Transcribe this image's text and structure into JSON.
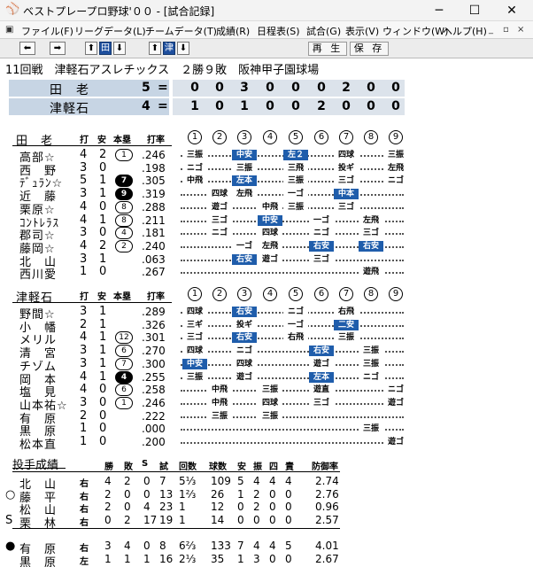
{
  "window": {
    "title": "ベストプレープロ野球'００ - [試合記録]",
    "min": "─",
    "max": "☐",
    "close": "✕"
  },
  "menu": [
    {
      "label": "ファイル(F)"
    },
    {
      "label": "リーグデータ(L)"
    },
    {
      "label": "チームデータ(T)"
    },
    {
      "label": "成績(R)"
    },
    {
      "label": "日程表(S)"
    },
    {
      "label": "試合(G)"
    },
    {
      "label": "表示(V)"
    },
    {
      "label": "ウィンドウ(W)"
    },
    {
      "label": "ヘルプ(H)"
    }
  ],
  "mdi": {
    "min": "_",
    "restore": "▫",
    "close": "×"
  },
  "toolbar": {
    "prev": "⬅",
    "next": "➡",
    "up1": "⬆",
    "team1": "田",
    "down1": "⬇",
    "up2": "⬆",
    "team2": "津",
    "down2": "⬇",
    "replay": "再 生",
    "save": "保 存"
  },
  "game": {
    "info": "11回戦　津軽石アスレチックス　２勝９敗　阪神甲子園球場",
    "line": [
      {
        "team": "田　老",
        "runs": "5",
        "eq": "=",
        "inn": [
          "0",
          "0",
          "3",
          "0",
          "0",
          "0",
          "2",
          "0",
          "0"
        ]
      },
      {
        "team": "津軽石",
        "runs": "4",
        "eq": "=",
        "inn": [
          "1",
          "0",
          "1",
          "0",
          "0",
          "2",
          "0",
          "0",
          "0"
        ]
      }
    ]
  },
  "headers": {
    "ab": "打",
    "h": "安",
    "hr": "本塁",
    "avg": "打率",
    "innings": [
      "1",
      "2",
      "3",
      "4",
      "5",
      "6",
      "7",
      "8",
      "9"
    ]
  },
  "away": {
    "team": "田　老",
    "batters": [
      {
        "name": "高部☆",
        "ab": "4",
        "h": "2",
        "hr": "1",
        "dark": false,
        "avg": ".246",
        "res": [
          [
            "三振",
            0
          ],
          [
            "",
            0
          ],
          [
            "中安",
            1
          ],
          [
            "",
            0
          ],
          [
            "左２",
            1
          ],
          [
            "",
            0
          ],
          [
            "四球",
            0
          ],
          [
            "",
            0
          ],
          [
            "三振",
            0
          ]
        ]
      },
      {
        "name": "西　野",
        "ab": "3",
        "h": "0",
        "hr": "",
        "dark": false,
        "avg": ".198",
        "res": [
          [
            "ニゴ",
            0
          ],
          [
            "",
            0
          ],
          [
            "三振",
            0
          ],
          [
            "",
            0
          ],
          [
            "三飛",
            0
          ],
          [
            "",
            0
          ],
          [
            "投ギ",
            0
          ],
          [
            "",
            0
          ],
          [
            "左飛",
            0
          ]
        ]
      },
      {
        "name": "ﾃﾞｭﾗﾝ☆",
        "ab": "5",
        "h": "1",
        "hr": "7",
        "dark": true,
        "avg": ".305",
        "res": [
          [
            "中飛",
            0
          ],
          [
            "",
            0
          ],
          [
            "左本",
            1
          ],
          [
            "",
            0
          ],
          [
            "三振",
            0
          ],
          [
            "",
            0
          ],
          [
            "三ゴ",
            0
          ],
          [
            "",
            0
          ],
          [
            "ニゴ",
            0
          ]
        ]
      },
      {
        "name": "近　藤",
        "ab": "3",
        "h": "1",
        "hr": "9",
        "dark": true,
        "avg": ".319",
        "res": [
          [
            "",
            0
          ],
          [
            "四球",
            0
          ],
          [
            "左飛",
            0
          ],
          [
            "",
            0
          ],
          [
            "一ゴ",
            0
          ],
          [
            "",
            0
          ],
          [
            "中本",
            1
          ],
          [
            "",
            0
          ],
          [
            "",
            0
          ]
        ]
      },
      {
        "name": "栗原☆",
        "ab": "4",
        "h": "0",
        "hr": "8",
        "dark": false,
        "avg": ".288",
        "res": [
          [
            "",
            0
          ],
          [
            "遊ゴ",
            0
          ],
          [
            "",
            0
          ],
          [
            "中飛",
            0
          ],
          [
            "三振",
            0
          ],
          [
            "",
            0
          ],
          [
            "三ゴ",
            0
          ],
          [
            "",
            0
          ],
          [
            "",
            0
          ]
        ]
      },
      {
        "name": "ｺﾝﾄﾚﾗｽ",
        "ab": "4",
        "h": "1",
        "hr": "8",
        "dark": false,
        "avg": ".211",
        "res": [
          [
            "",
            0
          ],
          [
            "三ゴ",
            0
          ],
          [
            "",
            0
          ],
          [
            "中安",
            1
          ],
          [
            "",
            0
          ],
          [
            "一ゴ",
            0
          ],
          [
            "",
            0
          ],
          [
            "左飛",
            0
          ],
          [
            "",
            0
          ]
        ]
      },
      {
        "name": "郡司☆",
        "ab": "3",
        "h": "0",
        "hr": "4",
        "dark": false,
        "avg": ".181",
        "res": [
          [
            "",
            0
          ],
          [
            "ニゴ",
            0
          ],
          [
            "",
            0
          ],
          [
            "四球",
            0
          ],
          [
            "",
            0
          ],
          [
            "ニゴ",
            0
          ],
          [
            "",
            0
          ],
          [
            "三ゴ",
            0
          ],
          [
            "",
            0
          ]
        ]
      },
      {
        "name": "藤岡☆",
        "ab": "4",
        "h": "2",
        "hr": "2",
        "dark": false,
        "avg": ".240",
        "res": [
          [
            "",
            0
          ],
          [
            "",
            0
          ],
          [
            "一ゴ",
            0
          ],
          [
            "左飛",
            0
          ],
          [
            "",
            0
          ],
          [
            "右安",
            1
          ],
          [
            "",
            0
          ],
          [
            "右安",
            1
          ],
          [
            "",
            0
          ]
        ]
      },
      {
        "name": "北　山",
        "ab": "3",
        "h": "1",
        "hr": "",
        "dark": false,
        "avg": ".063",
        "res": [
          [
            "",
            0
          ],
          [
            "",
            0
          ],
          [
            "右安",
            1
          ],
          [
            "遊ゴ",
            0
          ],
          [
            "",
            0
          ],
          [
            "三ゴ",
            0
          ],
          [
            "",
            0
          ],
          [
            "",
            0
          ],
          [
            "",
            0
          ]
        ]
      },
      {
        "name": "西川愛",
        "ab": "1",
        "h": "0",
        "hr": "",
        "dark": false,
        "avg": ".267",
        "res": [
          [
            "",
            0
          ],
          [
            "",
            0
          ],
          [
            "",
            0
          ],
          [
            "",
            0
          ],
          [
            "",
            0
          ],
          [
            "",
            0
          ],
          [
            "",
            0
          ],
          [
            "遊飛",
            0
          ],
          [
            "",
            0
          ]
        ]
      }
    ]
  },
  "home": {
    "team": "津軽石",
    "batters": [
      {
        "name": "野間☆",
        "ab": "3",
        "h": "1",
        "hr": "",
        "dark": false,
        "avg": ".289",
        "res": [
          [
            "四球",
            0
          ],
          [
            "",
            0
          ],
          [
            "右安",
            1
          ],
          [
            "",
            0
          ],
          [
            "ニゴ",
            0
          ],
          [
            "",
            0
          ],
          [
            "右飛",
            0
          ],
          [
            "",
            0
          ],
          [
            "",
            0
          ]
        ]
      },
      {
        "name": "小　幡",
        "ab": "2",
        "h": "1",
        "hr": "",
        "dark": false,
        "avg": ".326",
        "res": [
          [
            "三ギ",
            0
          ],
          [
            "",
            0
          ],
          [
            "投ギ",
            0
          ],
          [
            "",
            0
          ],
          [
            "一ゴ",
            0
          ],
          [
            "",
            0
          ],
          [
            "二安",
            1
          ],
          [
            "",
            0
          ],
          [
            "",
            0
          ]
        ]
      },
      {
        "name": "メリル",
        "ab": "4",
        "h": "1",
        "hr": "12",
        "dark": false,
        "avg": ".301",
        "res": [
          [
            "三ゴ",
            0
          ],
          [
            "",
            0
          ],
          [
            "右安",
            1
          ],
          [
            "",
            0
          ],
          [
            "右飛",
            0
          ],
          [
            "",
            0
          ],
          [
            "三振",
            0
          ],
          [
            "",
            0
          ],
          [
            "",
            0
          ]
        ]
      },
      {
        "name": "清　宮",
        "ab": "3",
        "h": "1",
        "hr": "6",
        "dark": false,
        "avg": ".270",
        "res": [
          [
            "四球",
            0
          ],
          [
            "",
            0
          ],
          [
            "ニゴ",
            0
          ],
          [
            "",
            0
          ],
          [
            "",
            0
          ],
          [
            "右安",
            1
          ],
          [
            "",
            0
          ],
          [
            "三振",
            0
          ],
          [
            "",
            0
          ]
        ]
      },
      {
        "name": "チゾム",
        "ab": "3",
        "h": "1",
        "hr": "7",
        "dark": false,
        "avg": ".300",
        "res": [
          [
            "中安",
            1
          ],
          [
            "",
            0
          ],
          [
            "四球",
            0
          ],
          [
            "",
            0
          ],
          [
            "",
            0
          ],
          [
            "遊ゴ",
            0
          ],
          [
            "",
            0
          ],
          [
            "三振",
            0
          ],
          [
            "",
            0
          ]
        ]
      },
      {
        "name": "岡　本",
        "ab": "4",
        "h": "1",
        "hr": "4",
        "dark": true,
        "avg": ".255",
        "res": [
          [
            "三振",
            0
          ],
          [
            "",
            0
          ],
          [
            "遊ゴ",
            0
          ],
          [
            "",
            0
          ],
          [
            "",
            0
          ],
          [
            "左本",
            1
          ],
          [
            "",
            0
          ],
          [
            "ニゴ",
            0
          ],
          [
            "",
            0
          ]
        ]
      },
      {
        "name": "塩　見",
        "ab": "4",
        "h": "0",
        "hr": "6",
        "dark": false,
        "avg": ".258",
        "res": [
          [
            "",
            0
          ],
          [
            "中飛",
            0
          ],
          [
            "",
            0
          ],
          [
            "三振",
            0
          ],
          [
            "",
            0
          ],
          [
            "遊直",
            0
          ],
          [
            "",
            0
          ],
          [
            "",
            0
          ],
          [
            "ニゴ",
            0
          ]
        ]
      },
      {
        "name": "山本祐☆",
        "ab": "3",
        "h": "0",
        "hr": "1",
        "dark": false,
        "avg": ".246",
        "res": [
          [
            "",
            0
          ],
          [
            "中飛",
            0
          ],
          [
            "",
            0
          ],
          [
            "四球",
            0
          ],
          [
            "",
            0
          ],
          [
            "三ゴ",
            0
          ],
          [
            "",
            0
          ],
          [
            "",
            0
          ],
          [
            "遊ゴ",
            0
          ]
        ]
      },
      {
        "name": "有　原",
        "ab": "2",
        "h": "0",
        "hr": "",
        "dark": false,
        "avg": ".222",
        "res": [
          [
            "",
            0
          ],
          [
            "三振",
            0
          ],
          [
            "",
            0
          ],
          [
            "三振",
            0
          ],
          [
            "",
            0
          ],
          [
            "",
            0
          ],
          [
            "",
            0
          ],
          [
            "",
            0
          ],
          [
            "",
            0
          ]
        ]
      },
      {
        "name": "黒　原",
        "ab": "1",
        "h": "0",
        "hr": "",
        "dark": false,
        "avg": ".000",
        "res": [
          [
            "",
            0
          ],
          [
            "",
            0
          ],
          [
            "",
            0
          ],
          [
            "",
            0
          ],
          [
            "",
            0
          ],
          [
            "",
            0
          ],
          [
            "",
            0
          ],
          [
            "三振",
            0
          ],
          [
            "",
            0
          ]
        ]
      },
      {
        "name": "松本直",
        "ab": "1",
        "h": "0",
        "hr": "",
        "dark": false,
        "avg": ".200",
        "res": [
          [
            "",
            0
          ],
          [
            "",
            0
          ],
          [
            "",
            0
          ],
          [
            "",
            0
          ],
          [
            "",
            0
          ],
          [
            "",
            0
          ],
          [
            "",
            0
          ],
          [
            "",
            0
          ],
          [
            "遊ゴ",
            0
          ]
        ]
      }
    ]
  },
  "pitching": {
    "title": "投手成績",
    "headers": [
      "勝",
      "敗",
      "S",
      "試",
      "回数",
      "球数",
      "安",
      "振",
      "四",
      "責",
      "防御率"
    ],
    "pitchers": [
      {
        "mark": "",
        "name": "北　山",
        "hand": "右",
        "w": "4",
        "l": "2",
        "s": "0",
        "g": "7",
        "ip": "5⅓",
        "np": "109",
        "h": "5",
        "so": "4",
        "bb": "4",
        "er": "4",
        "era": "2.74"
      },
      {
        "mark": "○",
        "name": "藤　平",
        "hand": "右",
        "w": "2",
        "l": "0",
        "s": "0",
        "g": "13",
        "ip": "1⅔",
        "np": "26",
        "h": "1",
        "so": "2",
        "bb": "0",
        "er": "0",
        "era": "2.76"
      },
      {
        "mark": "",
        "name": "松　山",
        "hand": "右",
        "w": "2",
        "l": "0",
        "s": "4",
        "g": "23",
        "ip": "1",
        "np": "12",
        "h": "0",
        "so": "2",
        "bb": "0",
        "er": "0",
        "era": "0.96"
      },
      {
        "mark": "S",
        "name": "栗　林",
        "hand": "右",
        "w": "0",
        "l": "2",
        "s": "17",
        "g": "19",
        "ip": "1",
        "np": "14",
        "h": "0",
        "so": "0",
        "bb": "0",
        "er": "0",
        "era": "2.57"
      },
      {
        "mark": "●",
        "name": "有　原",
        "hand": "右",
        "w": "3",
        "l": "4",
        "s": "0",
        "g": "8",
        "ip": "6⅔",
        "np": "133",
        "h": "7",
        "so": "4",
        "bb": "4",
        "er": "5",
        "era": "4.01"
      },
      {
        "mark": "",
        "name": "黒　原",
        "hand": "左",
        "w": "1",
        "l": "1",
        "s": "1",
        "g": "16",
        "ip": "2⅓",
        "np": "35",
        "h": "1",
        "so": "3",
        "bb": "0",
        "er": "0",
        "era": "2.67"
      }
    ]
  }
}
